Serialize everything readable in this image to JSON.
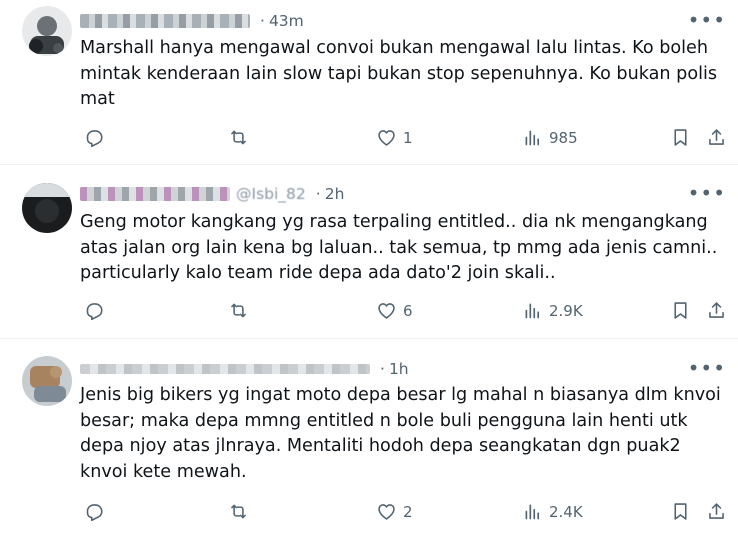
{
  "tweets": [
    {
      "time": "43m",
      "handle": "",
      "text": "Marshall hanya mengawal convoi bukan mengawal lalu lintas. Ko boleh mintak kenderaan lain slow tapi bukan stop sepenuhnya. Ko bukan polis mat",
      "likes": "1",
      "views": "985"
    },
    {
      "time": "2h",
      "handle": "@Isbi_82",
      "text": "Geng motor kangkang yg rasa terpaling entitled.. dia nk mengangkang atas jalan org lain kena bg laluan.. tak semua, tp mmg ada jenis camni.. particularly kalo team ride depa ada dato'2 join skali..",
      "likes": "6",
      "views": "2.9K"
    },
    {
      "time": "1h",
      "handle": "",
      "text": "Jenis big bikers yg ingat moto depa besar lg mahal n biasanya dlm knvoi besar; maka depa mmng entitled n bole buli pengguna lain henti utk depa njoy atas jlnraya. Mentaliti hodoh depa seangkatan dgn puak2 knvoi kete mewah.",
      "likes": "2",
      "views": "2.4K"
    }
  ],
  "icons": {
    "reply": "reply-icon",
    "retweet": "retweet-icon",
    "like": "heart-icon",
    "views": "views-icon",
    "bookmark": "bookmark-icon",
    "share": "share-icon",
    "more": "more-icon"
  },
  "colors": {
    "text": "#0f1419",
    "muted": "#536471",
    "divider": "#eff3f4"
  }
}
